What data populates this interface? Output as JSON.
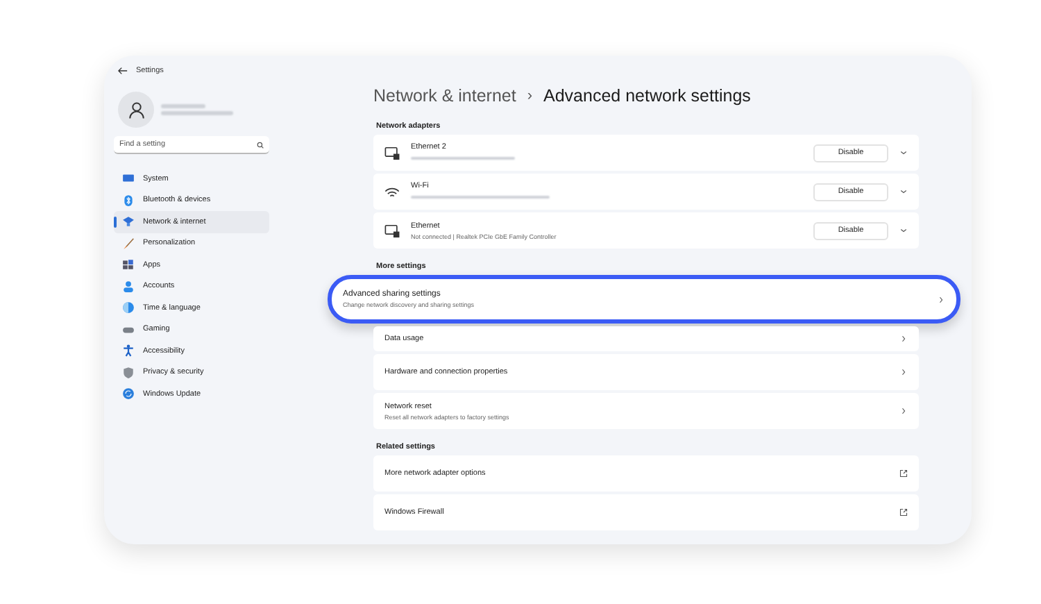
{
  "window": {
    "title": "Settings"
  },
  "search": {
    "placeholder": "Find a setting"
  },
  "sidebar": {
    "items": [
      {
        "label": "System",
        "selected": false
      },
      {
        "label": "Bluetooth & devices",
        "selected": false
      },
      {
        "label": "Network & internet",
        "selected": true
      },
      {
        "label": "Personalization",
        "selected": false
      },
      {
        "label": "Apps",
        "selected": false
      },
      {
        "label": "Accounts",
        "selected": false
      },
      {
        "label": "Time & language",
        "selected": false
      },
      {
        "label": "Gaming",
        "selected": false
      },
      {
        "label": "Accessibility",
        "selected": false
      },
      {
        "label": "Privacy & security",
        "selected": false
      },
      {
        "label": "Windows Update",
        "selected": false
      }
    ]
  },
  "breadcrumb": {
    "parent": "Network & internet",
    "separator": "›",
    "current": "Advanced network settings"
  },
  "network_adapters": {
    "heading": "Network adapters",
    "items": [
      {
        "name": "Ethernet 2",
        "kind": "ethernet",
        "button": "Disable"
      },
      {
        "name": "Wi-Fi",
        "kind": "wifi",
        "button": "Disable"
      },
      {
        "name": "Ethernet",
        "kind": "ethernet",
        "description": "Not connected | Realtek PCIe GbE Family Controller",
        "button": "Disable"
      }
    ]
  },
  "more_settings": {
    "heading": "More settings",
    "items": [
      {
        "title": "Advanced sharing settings",
        "description": "Change network discovery and sharing settings",
        "highlighted": true
      },
      {
        "title": "Data usage",
        "highlighted": false
      },
      {
        "title": "Hardware and connection properties",
        "highlighted": false
      },
      {
        "title": "Network reset",
        "description": "Reset all network adapters to factory settings",
        "highlighted": false
      }
    ]
  },
  "related_settings": {
    "heading": "Related settings",
    "items": [
      {
        "title": "More network adapter options"
      },
      {
        "title": "Windows Firewall"
      }
    ]
  }
}
